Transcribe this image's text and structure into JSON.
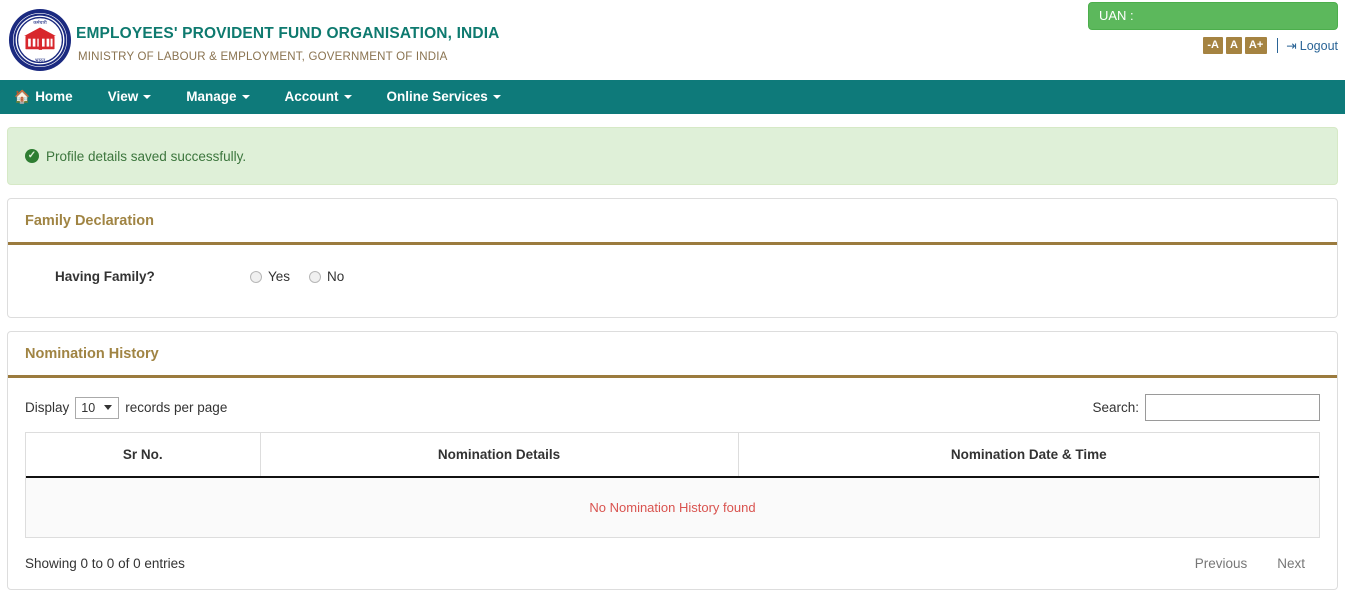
{
  "header": {
    "org_name": "EMPLOYEES' PROVIDENT FUND ORGANISATION, INDIA",
    "ministry": "MINISTRY OF LABOUR & EMPLOYMENT, GOVERNMENT OF INDIA",
    "logo_icon": "epfo-emblem-icon",
    "uan_label": "UAN :",
    "font_decrease": "-A",
    "font_normal": "A",
    "font_increase": "A+",
    "logout_label": "Logout",
    "logout_icon": "logout-icon",
    "accent_green": "#5cb85c",
    "brand_teal": "#0e7a6f",
    "brand_gold": "#a58341"
  },
  "nav": {
    "items": [
      {
        "label": "Home",
        "icon": "home-icon",
        "caret": false
      },
      {
        "label": "View",
        "icon": "",
        "caret": true
      },
      {
        "label": "Manage",
        "icon": "",
        "caret": true
      },
      {
        "label": "Account",
        "icon": "",
        "caret": true
      },
      {
        "label": "Online Services",
        "icon": "",
        "caret": true
      }
    ],
    "bar_color": "#0e7a7a"
  },
  "alert": {
    "icon": "check-circle-icon",
    "message": "Profile details saved successfully.",
    "bg_color": "#dff0d8",
    "text_color": "#3c763d"
  },
  "family_panel": {
    "title": "Family Declaration",
    "question_label": "Having Family?",
    "options": [
      {
        "label": "Yes",
        "selected": false
      },
      {
        "label": "No",
        "selected": false
      }
    ]
  },
  "nomination_panel": {
    "title": "Nomination History",
    "display_prefix": "Display",
    "records_per_page": "10",
    "display_suffix": "records per page",
    "search_label": "Search:",
    "search_value": "",
    "search_placeholder": "",
    "columns": [
      "Sr No.",
      "Nomination Details",
      "Nomination Date & Time"
    ],
    "empty_message": "No Nomination History found",
    "empty_text_color": "#d9534f",
    "info_text": "Showing 0 to 0 of 0 entries",
    "previous_label": "Previous",
    "next_label": "Next"
  }
}
